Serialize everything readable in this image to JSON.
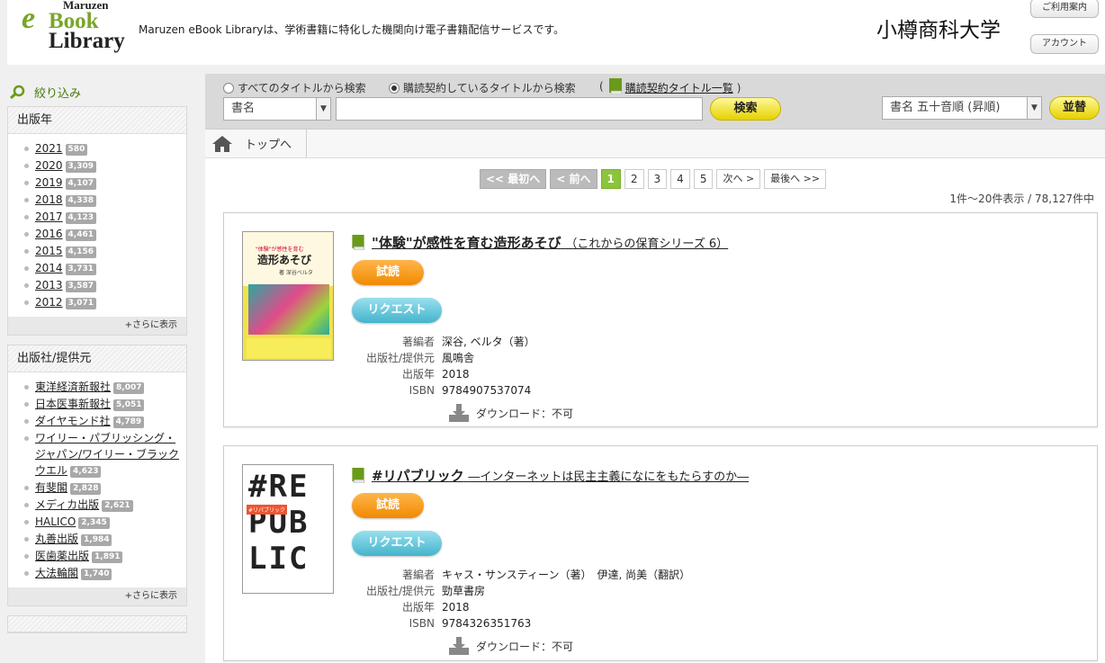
{
  "header": {
    "logo_top": "Maruzen",
    "logo_e": "e",
    "logo_book": "Book",
    "logo_library": "Library",
    "tagline": "Maruzen eBook Libraryは、学術書籍に特化した機関向け電子書籍配信サービスです。",
    "university": "小樽商科大学",
    "guide_button": "ご利用案内",
    "account_button": "アカウント"
  },
  "sidebar": {
    "filter_label": "絞り込み",
    "year_panel": {
      "title": "出版年",
      "items": [
        {
          "label": "2021",
          "count": "580"
        },
        {
          "label": "2020",
          "count": "3,309"
        },
        {
          "label": "2019",
          "count": "4,107"
        },
        {
          "label": "2018",
          "count": "4,338"
        },
        {
          "label": "2017",
          "count": "4,123"
        },
        {
          "label": "2016",
          "count": "4,461"
        },
        {
          "label": "2015",
          "count": "4,156"
        },
        {
          "label": "2014",
          "count": "3,731"
        },
        {
          "label": "2013",
          "count": "3,587"
        },
        {
          "label": "2012",
          "count": "3,071"
        }
      ],
      "more": "+さらに表示"
    },
    "publisher_panel": {
      "title": "出版社/提供元",
      "items": [
        {
          "label": "東洋経済新報社",
          "count": "8,007"
        },
        {
          "label": "日本医事新報社",
          "count": "5,051"
        },
        {
          "label": "ダイヤモンド社",
          "count": "4,789"
        },
        {
          "label": "ワイリー・パブリッシング・ジャパン/ワイリー・ブラックウエル",
          "count": "4,623"
        },
        {
          "label": "有斐閣",
          "count": "2,828"
        },
        {
          "label": "メディカ出版",
          "count": "2,621"
        },
        {
          "label": "HALICO",
          "count": "2,345"
        },
        {
          "label": "丸善出版",
          "count": "1,984"
        },
        {
          "label": "医歯薬出版",
          "count": "1,891"
        },
        {
          "label": "大法輪閣",
          "count": "1,740"
        }
      ],
      "more": "+さらに表示"
    }
  },
  "search": {
    "radio_all": "すべてのタイトルから検索",
    "radio_subscribed": "購読契約しているタイトルから検索",
    "list_paren_open": "(",
    "list_link": "購読契約タイトル一覧",
    "list_paren_close": ")",
    "field_select": "書名",
    "query": "",
    "search_button": "検索",
    "sort_select": "書名 五十音順 (昇順)",
    "sort_button": "並替"
  },
  "breadcrumb": {
    "home": "トップへ"
  },
  "pagination": {
    "first": "<< 最初へ",
    "prev": "< 前へ",
    "pages": [
      "1",
      "2",
      "3",
      "4",
      "5"
    ],
    "current": "1",
    "next": "次へ >",
    "last": "最後へ >>",
    "result_count": "1件～20件表示 / 78,127件中"
  },
  "labels": {
    "trial": "試読",
    "request": "リクエスト",
    "author": "著編者",
    "publisher": "出版社/提供元",
    "year": "出版年",
    "isbn": "ISBN",
    "download": "ダウンロード：不可"
  },
  "books": [
    {
      "title": "\"体験\"が感性を育む造形あそび",
      "subtitle": "（これからの保育シリーズ 6）",
      "author": "深谷, ベルタ（著）",
      "publisher": "風鳴舎",
      "year": "2018",
      "isbn": "9784907537074",
      "cover_top": "\"体験\"が感性を育む",
      "cover_title": "造形あそび",
      "cover_author": "著 深谷ベルタ"
    },
    {
      "title": "#リパブリック",
      "subtitle": "―インターネットは民主主義になにをもたらすのか―",
      "author": "キャス・サンスティーン（著）　伊達, 尚美（翻訳）",
      "publisher": "勁草書房",
      "year": "2018",
      "isbn": "9784326351763",
      "cover_lines": [
        "#RE",
        "PUB",
        "LIC"
      ],
      "cover_tag": "#リパブリック"
    }
  ]
}
